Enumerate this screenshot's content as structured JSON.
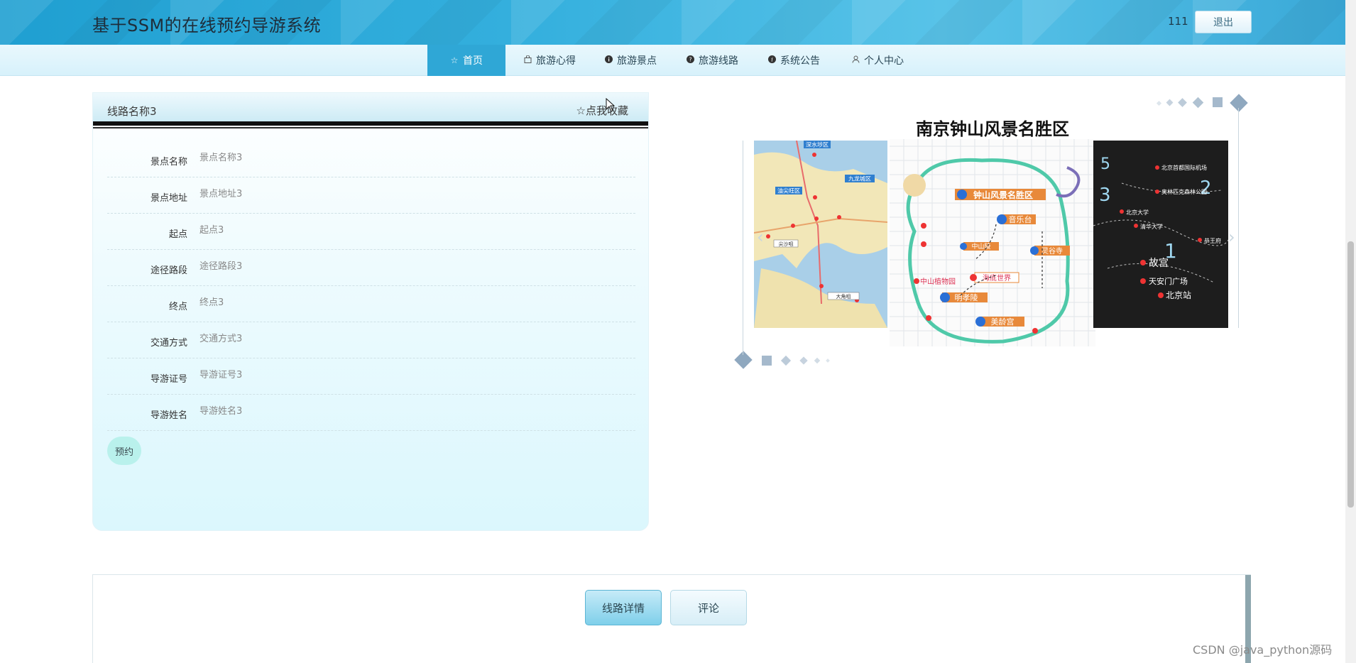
{
  "header": {
    "site_title": "基于SSM的在线预约导游系统",
    "username": "111",
    "logout_label": "退出"
  },
  "nav": {
    "items": [
      {
        "label": "首页",
        "icon": "star-icon",
        "active": true
      },
      {
        "label": "旅游心得",
        "icon": "bag-icon",
        "active": false
      },
      {
        "label": "旅游景点",
        "icon": "info-icon",
        "active": false
      },
      {
        "label": "旅游线路",
        "icon": "question-icon",
        "active": false
      },
      {
        "label": "系统公告",
        "icon": "info-icon",
        "active": false
      },
      {
        "label": "个人中心",
        "icon": "user-icon",
        "active": false
      }
    ]
  },
  "detail": {
    "route_name": "线路名称3",
    "favorite_label": "☆点我收藏",
    "fields": [
      {
        "label": "景点名称",
        "value": "景点名称3"
      },
      {
        "label": "景点地址",
        "value": "景点地址3"
      },
      {
        "label": "起点",
        "value": "起点3"
      },
      {
        "label": "途径路段",
        "value": "途径路段3"
      },
      {
        "label": "终点",
        "value": "终点3"
      },
      {
        "label": "交通方式",
        "value": "交通方式3"
      },
      {
        "label": "导游证号",
        "value": "导游证号3"
      },
      {
        "label": "导游姓名",
        "value": "导游姓名3"
      }
    ],
    "book_label": "预约"
  },
  "carousel": {
    "nanjing_title": "南京钟山风景名胜区",
    "nanjing_spots": [
      "钟山风景名胜区",
      "音乐台",
      "明孝陵",
      "海底世界",
      "美龄宫",
      "中山植物园",
      "灵谷寺",
      "中山陵"
    ],
    "hk_labels": [
      "深水埗区",
      "九龙城区",
      "油尖旺区",
      "尖沙咀",
      "大角咀"
    ],
    "beijing_spots": [
      "北京首都国际机场",
      "奥林匹克森林公园",
      "故宫",
      "天安门广场",
      "北京站",
      "北京大学",
      "清华大学",
      "恭王府"
    ],
    "beijing_numbers": [
      "5",
      "3",
      "2",
      "1"
    ]
  },
  "tabs": {
    "items": [
      {
        "label": "线路详情",
        "active": true
      },
      {
        "label": "评论",
        "active": false
      }
    ]
  },
  "watermark": "CSDN @java_python源码"
}
